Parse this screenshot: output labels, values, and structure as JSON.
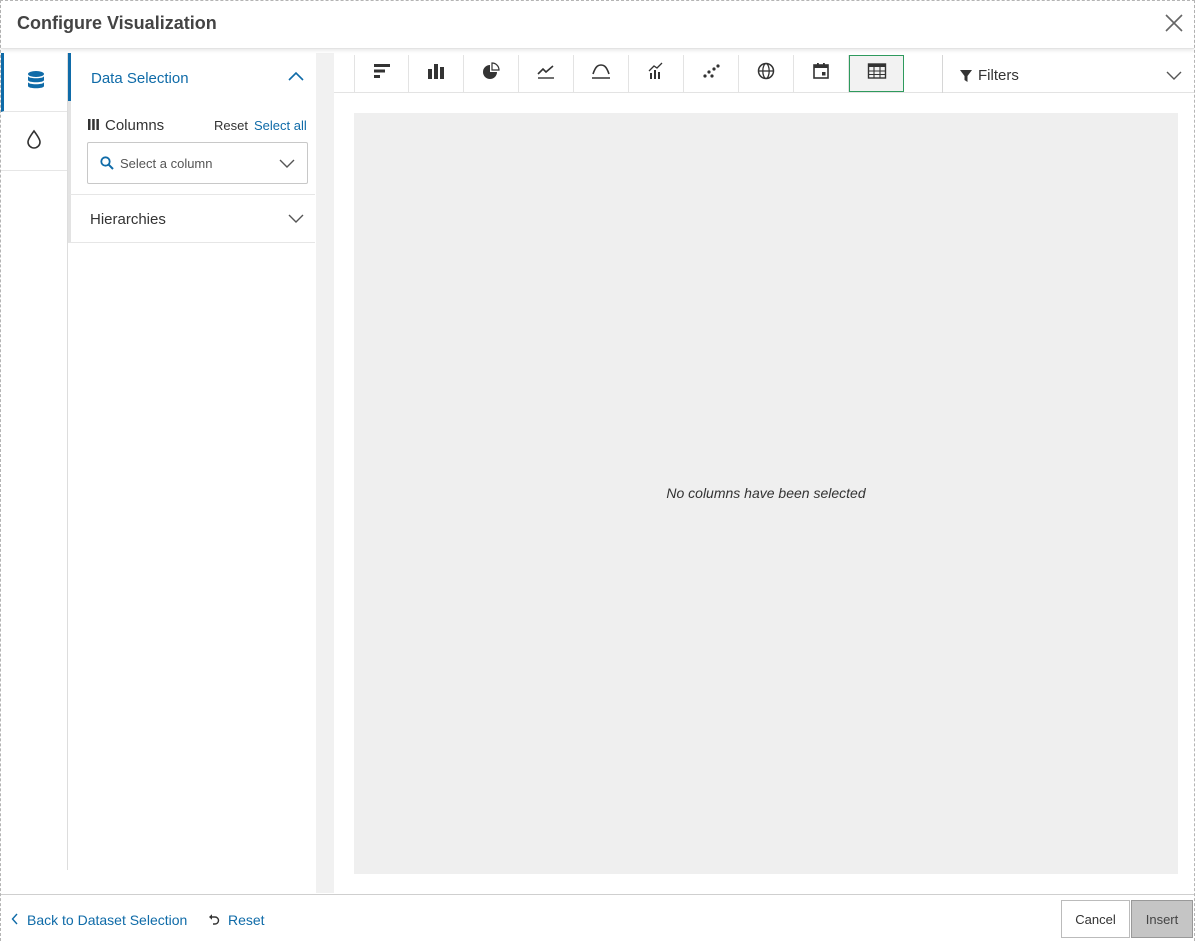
{
  "dialog": {
    "title": "Configure Visualization",
    "close_icon": "close-icon"
  },
  "rail": {
    "items": [
      {
        "icon": "database-icon",
        "active": true
      },
      {
        "icon": "droplet-icon",
        "active": false
      }
    ]
  },
  "data_selection": {
    "title": "Data Selection",
    "expanded": true,
    "columns_label": "Columns",
    "reset_label": "Reset",
    "select_all_label": "Select all",
    "column_placeholder": "Select a column",
    "hierarchies_label": "Hierarchies"
  },
  "toolbar": {
    "chart_types": [
      {
        "icon": "horizontal-bar-chart-icon",
        "active": false
      },
      {
        "icon": "bar-chart-icon",
        "active": false
      },
      {
        "icon": "pie-chart-icon",
        "active": false
      },
      {
        "icon": "line-chart-icon",
        "active": false
      },
      {
        "icon": "area-chart-icon",
        "active": false
      },
      {
        "icon": "combo-chart-icon",
        "active": false
      },
      {
        "icon": "scatter-chart-icon",
        "active": false
      },
      {
        "icon": "globe-map-icon",
        "active": false
      },
      {
        "icon": "calendar-icon",
        "active": false
      },
      {
        "icon": "table-icon",
        "active": true
      }
    ],
    "filters_label": "Filters"
  },
  "preview": {
    "empty_message": "No columns have been selected"
  },
  "footer": {
    "back_label": "Back to Dataset Selection",
    "reset_label": "Reset",
    "cancel_label": "Cancel",
    "insert_label": "Insert"
  },
  "colors": {
    "accent": "#0f6ba8",
    "active_border": "#2e9a5d"
  }
}
